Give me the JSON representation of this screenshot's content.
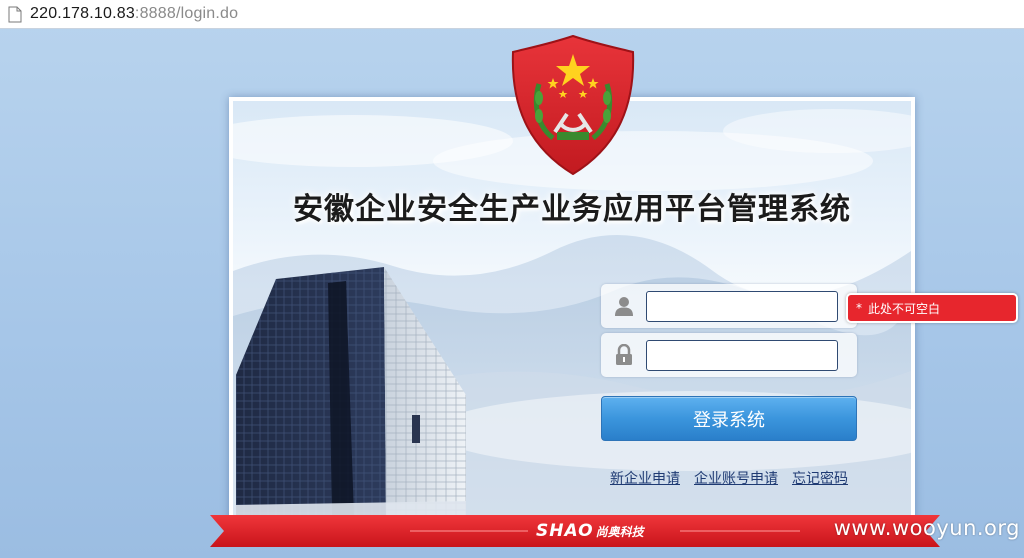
{
  "browser": {
    "url_host": "220.178.10.83",
    "url_rest": ":8888/login.do"
  },
  "page": {
    "title": "安徽企业安全生产业务应用平台管理系统"
  },
  "login_form": {
    "username_value": "",
    "password_value": "",
    "username_error": "此处不可空白",
    "error_marker": "*",
    "submit_label": "登录系统"
  },
  "links": {
    "new_company": "新企业申请",
    "company_account": "企业账号申请",
    "forgot_password": "忘记密码"
  },
  "footer": {
    "brand": "SHAO",
    "brand_sub": "尚奥科技",
    "watermark": "www.wooyun.org"
  },
  "icons": {
    "page": "page-icon",
    "emblem": "emblem-icon",
    "user": "user-icon",
    "lock": "lock-icon"
  },
  "colors": {
    "background": "#a6c6e8",
    "emblem_red": "#d9262b",
    "emblem_gold": "#ffd21f",
    "error_red": "#e7262d",
    "button_blue": "#3b95dd",
    "ribbon_red": "#e31b23",
    "link": "#1e3a73"
  }
}
